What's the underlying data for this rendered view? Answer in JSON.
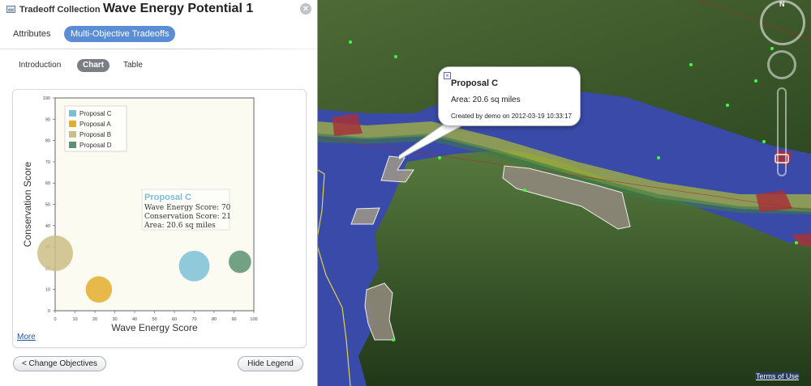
{
  "header": {
    "collection_label": "Tradeoff Collection",
    "title": "Wave Energy Potential 1",
    "close_icon": "close-icon"
  },
  "main_tabs": [
    {
      "label": "Attributes"
    },
    {
      "label": "Multi-Objective Tradeoffs",
      "active": true
    }
  ],
  "sub_tabs": [
    {
      "label": "Introduction"
    },
    {
      "label": "Chart",
      "active": true
    },
    {
      "label": "Table"
    }
  ],
  "chart_data": {
    "type": "scatter",
    "xlabel": "Wave Energy Score",
    "ylabel": "Conservation Score",
    "xlim": [
      0,
      100
    ],
    "ylim": [
      0,
      100
    ],
    "xticks": [
      0,
      10,
      20,
      30,
      40,
      50,
      60,
      70,
      80,
      90,
      100
    ],
    "yticks": [
      0,
      10,
      20,
      30,
      40,
      50,
      60,
      70,
      80,
      90,
      100
    ],
    "grid": false,
    "legend_position": "top-left",
    "series": [
      {
        "name": "Proposal C",
        "color": "#7bbfd6",
        "x": 70,
        "y": 21,
        "area": 20.6
      },
      {
        "name": "Proposal A",
        "color": "#e3ad2e",
        "x": 22,
        "y": 10,
        "area": 14
      },
      {
        "name": "Proposal B",
        "color": "#cdbd86",
        "x": 0,
        "y": 27,
        "area": 30
      },
      {
        "name": "Proposal D",
        "color": "#5b9170",
        "x": 93,
        "y": 23,
        "area": 9
      }
    ],
    "tooltip": {
      "title": "Proposal C",
      "lines": [
        "Wave Energy Score: 70",
        "Conservation Score: 21",
        "Area: 20.6 sq miles"
      ]
    }
  },
  "more_link": "More",
  "buttons": {
    "change_objectives": "< Change Objectives",
    "hide_legend": "Hide Legend"
  },
  "popup": {
    "title": "Proposal C",
    "area": "Area: 20.6 sq miles",
    "created": "Created by demo on 2012-03-19 10:33:17",
    "close_icon": "close-box-icon"
  },
  "map": {
    "terms_link": "Terms of Use",
    "compass_label": "N",
    "ocean_color": "#3a4aa8",
    "land_color": "#3d5a2a"
  }
}
